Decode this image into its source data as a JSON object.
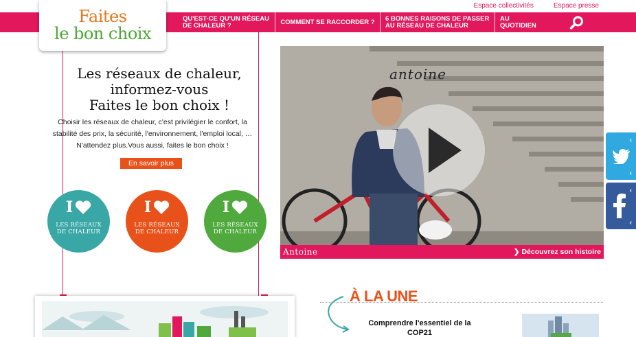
{
  "top_links": [
    "Espace collectivités",
    "Espace presse"
  ],
  "logo": {
    "line1": "Faites",
    "line2": "le bon choix"
  },
  "nav": {
    "items": [
      "QU'EST-CE QU'UN RÉSEAU DE CHALEUR ?",
      "COMMENT SE RACCORDER ?",
      "6 BONNES RAISONS DE PASSER AU RÉSEAU DE CHALEUR",
      "AU QUOTIDIEN"
    ],
    "search_icon": "search-icon"
  },
  "intro": {
    "title_lines": [
      "Les réseaux de chaleur,",
      "informez-vous",
      "Faites le bon choix !"
    ],
    "text": "Choisir les réseaux de chaleur, c'est privilégier le confort, la stabilité des prix, la sécurité, l'environnement, l'emploi local, … N'attendez plus.Vous aussi, faites le bon choix !",
    "cta": "En savoir plus"
  },
  "badges": [
    {
      "letter": "I",
      "line1": "LES RÉSEAUX",
      "line2": "DE CHALEUR",
      "color": "#39a7a5"
    },
    {
      "letter": "I",
      "line1": "LES RÉSEAUX",
      "line2": "DE CHALEUR",
      "color": "#e8521a"
    },
    {
      "letter": "I",
      "line1": "LES RÉSEAUX",
      "line2": "DE CHALEUR",
      "color": "#4fa93c"
    }
  ],
  "video": {
    "overlay_name": "antoine",
    "bar_name": "Antoine",
    "discover": "Découvrez son histoire"
  },
  "news": {
    "title": "À LA UNE",
    "article_title": "Comprendre l'essentiel de la COP21"
  },
  "colors": {
    "brand_pink": "#e2175c",
    "orange": "#e8521a",
    "green": "#4aa834",
    "teal": "#39a7a5",
    "twitter": "#30a9e0",
    "facebook": "#355b9c"
  }
}
